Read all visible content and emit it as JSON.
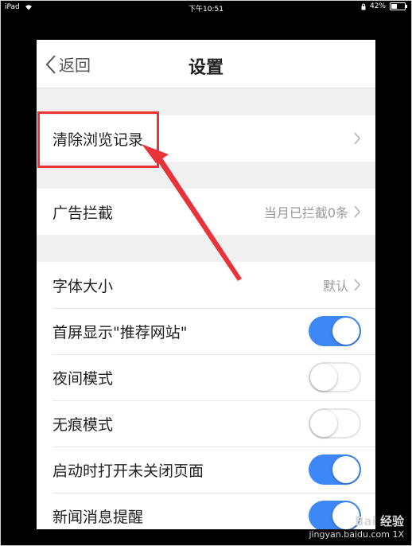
{
  "statusbar": {
    "device": "iPad",
    "time": "下午10:51",
    "battery": "42%",
    "battery_level": 0.42
  },
  "navbar": {
    "back_label": "返回",
    "title": "设置"
  },
  "settings": {
    "clear_history": "清除浏览记录",
    "ad_block": {
      "label": "广告拦截",
      "value": "当月已拦截0条"
    },
    "font_size": {
      "label": "字体大小",
      "value": "默认"
    },
    "toggles": [
      {
        "label": "首屏显示\"推荐网站\"",
        "on": true
      },
      {
        "label": "夜间模式",
        "on": false
      },
      {
        "label": "无痕模式",
        "on": false
      },
      {
        "label": "启动时打开未关闭页面",
        "on": true
      },
      {
        "label": "新闻消息提醒",
        "on": true
      }
    ]
  },
  "watermark": {
    "brand": "Bai 经验",
    "url": "jingyan.baidu.com",
    "zoom": "1X"
  },
  "colors": {
    "accent": "#3e87f6",
    "annotation": "#e8333a"
  },
  "icons": {
    "back": "chevron-left-icon",
    "chevron": "chevron-right-icon",
    "wifi": "wifi-icon",
    "battery": "battery-icon"
  }
}
